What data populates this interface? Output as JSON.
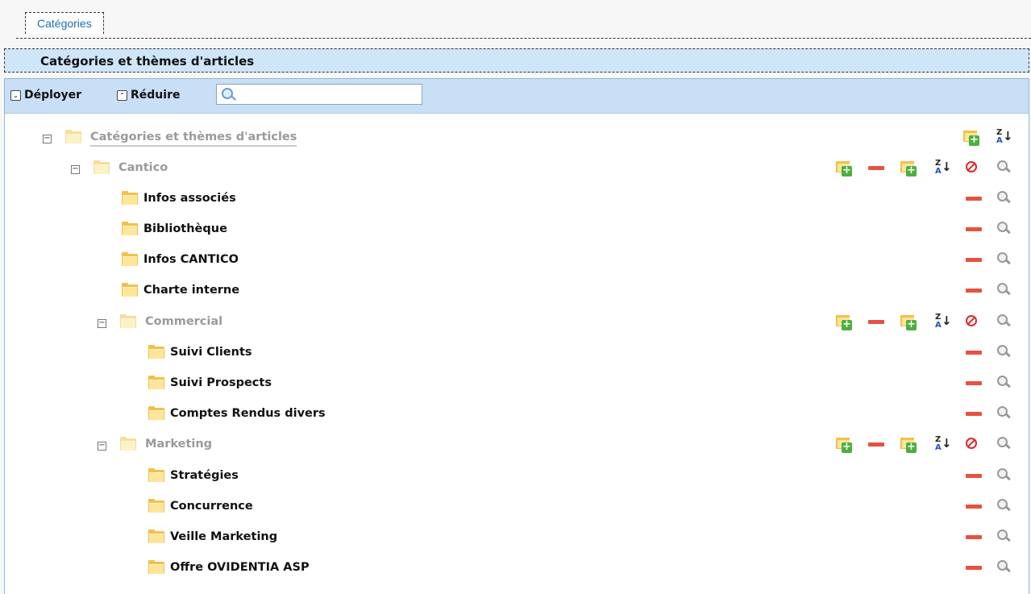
{
  "tabs": [
    {
      "label": "Catégories"
    }
  ],
  "section": {
    "title": "Catégories et thèmes d'articles"
  },
  "toolbar": {
    "expand_label": "Déployer",
    "collapse_label": "Réduire",
    "search_placeholder": "",
    "search_value": ""
  },
  "tree": {
    "root": {
      "label": "Catégories et thèmes d'articles"
    },
    "cantico": {
      "label": "Cantico"
    },
    "cantico_items": [
      {
        "label": "Infos associés"
      },
      {
        "label": "Bibliothèque"
      },
      {
        "label": "Infos CANTICO"
      },
      {
        "label": "Charte interne"
      }
    ],
    "commercial": {
      "label": "Commercial"
    },
    "commercial_items": [
      {
        "label": "Suivi Clients"
      },
      {
        "label": "Suivi Prospects"
      },
      {
        "label": "Comptes Rendus divers"
      }
    ],
    "marketing": {
      "label": "Marketing"
    },
    "marketing_items": [
      {
        "label": "Stratégies"
      },
      {
        "label": "Concurrence"
      },
      {
        "label": "Veille Marketing"
      },
      {
        "label": "Offre OVIDENTIA ASP"
      }
    ]
  },
  "icons": {
    "toggle_collapse": "minus-box-icon",
    "folder": "folder-icon",
    "add_category": "add-folder-icon",
    "remove": "remove-icon",
    "add_topic": "add-topic-icon",
    "sort": "sort-az-icon",
    "forbid": "forbidden-icon",
    "view": "magnifier-icon"
  },
  "colors": {
    "section_bg": "#cfe5f8",
    "toolbar_bg": "#c8dff5",
    "tab_text": "#1a6fb5",
    "remove_red": "#e5523f",
    "folder_yellow": "#f3c04a"
  }
}
